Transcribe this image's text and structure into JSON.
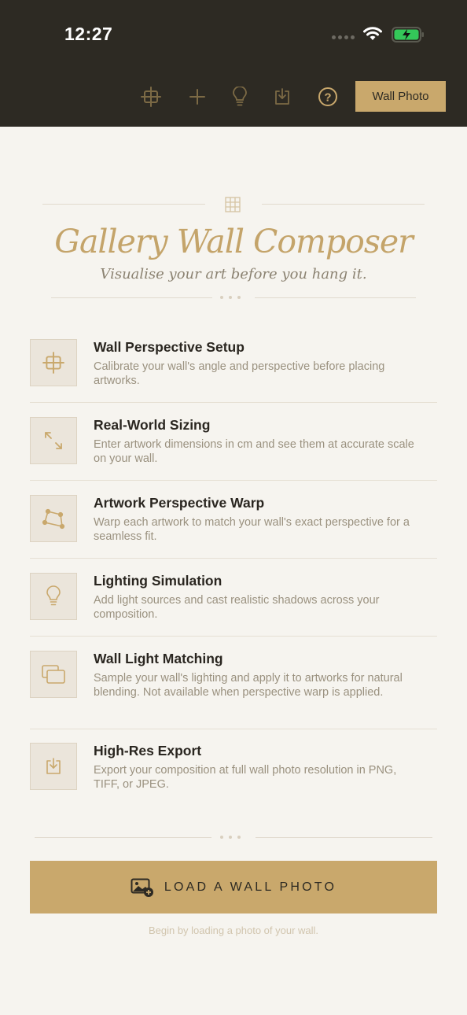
{
  "status_bar": {
    "time": "12:27"
  },
  "toolbar": {
    "icons": [
      "crop-perspective-icon",
      "plus-icon",
      "lightbulb-icon",
      "download-icon",
      "help-icon"
    ],
    "wall_photo_label": "Wall Photo"
  },
  "header": {
    "title": "Gallery Wall Composer",
    "subtitle": "Visualise your art before you hang it."
  },
  "features": [
    {
      "icon": "crop-perspective-icon",
      "title": "Wall Perspective Setup",
      "description": "Calibrate your wall's angle and perspective before placing artworks."
    },
    {
      "icon": "resize-arrows-icon",
      "title": "Real-World Sizing",
      "description": "Enter artwork dimensions in cm and see them at accurate scale on your wall."
    },
    {
      "icon": "perspective-warp-icon",
      "title": "Artwork Perspective Warp",
      "description": "Warp each artwork to match your wall's exact perspective for a seamless fit."
    },
    {
      "icon": "lightbulb-icon",
      "title": "Lighting Simulation",
      "description": "Add light sources and cast realistic shadows across your composition."
    },
    {
      "icon": "stacked-frames-icon",
      "title": "Wall Light Matching",
      "description": "Sample your wall's lighting and apply it to artworks for natural blending. Not available when perspective warp is applied."
    },
    {
      "icon": "download-icon",
      "title": "High-Res Export",
      "description": "Export your composition at full wall photo resolution in PNG, TIFF, or JPEG."
    }
  ],
  "load_button": {
    "icon": "add-image-icon",
    "label": "LOAD A WALL PHOTO"
  },
  "hint": "Begin by loading a photo of your wall.",
  "colors": {
    "bar": "#2d2a23",
    "accent": "#c9a86c",
    "background": "#f6f4ef",
    "title": "#c4a46a"
  }
}
